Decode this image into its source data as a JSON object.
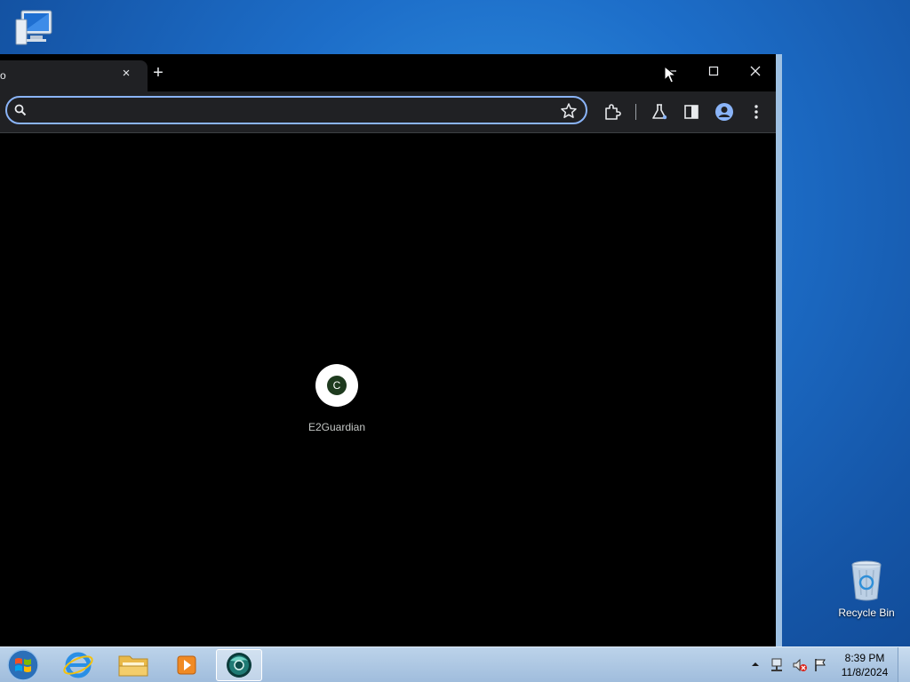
{
  "desktop": {
    "icons": [
      {
        "name": "computer",
        "label": ""
      },
      {
        "name": "recycle-bin",
        "label": "Recycle Bin"
      }
    ]
  },
  "browser": {
    "tab": {
      "title": "o",
      "close_symbol": "×"
    },
    "new_tab_symbol": "+",
    "window_controls": {
      "minimize": "—",
      "maximize": "☐",
      "close": "✕"
    },
    "omnibox": {
      "value": "",
      "placeholder": ""
    },
    "toolbar_icons": [
      "search-icon",
      "star-icon",
      "extensions-icon",
      "labs-icon",
      "side-panel-icon",
      "profile-icon",
      "menu-icon"
    ],
    "accent_color": "#8ab4f8",
    "shortcut": {
      "initial": "C",
      "label": "E2Guardian"
    }
  },
  "taskbar": {
    "items": [
      "start",
      "internet-explorer",
      "file-explorer",
      "media-player",
      "chrome"
    ],
    "tray_icons": [
      "network-icon",
      "volume-muted-icon",
      "action-center-flag-icon"
    ],
    "clock": {
      "time": "8:39 PM",
      "date": "11/8/2024"
    }
  }
}
